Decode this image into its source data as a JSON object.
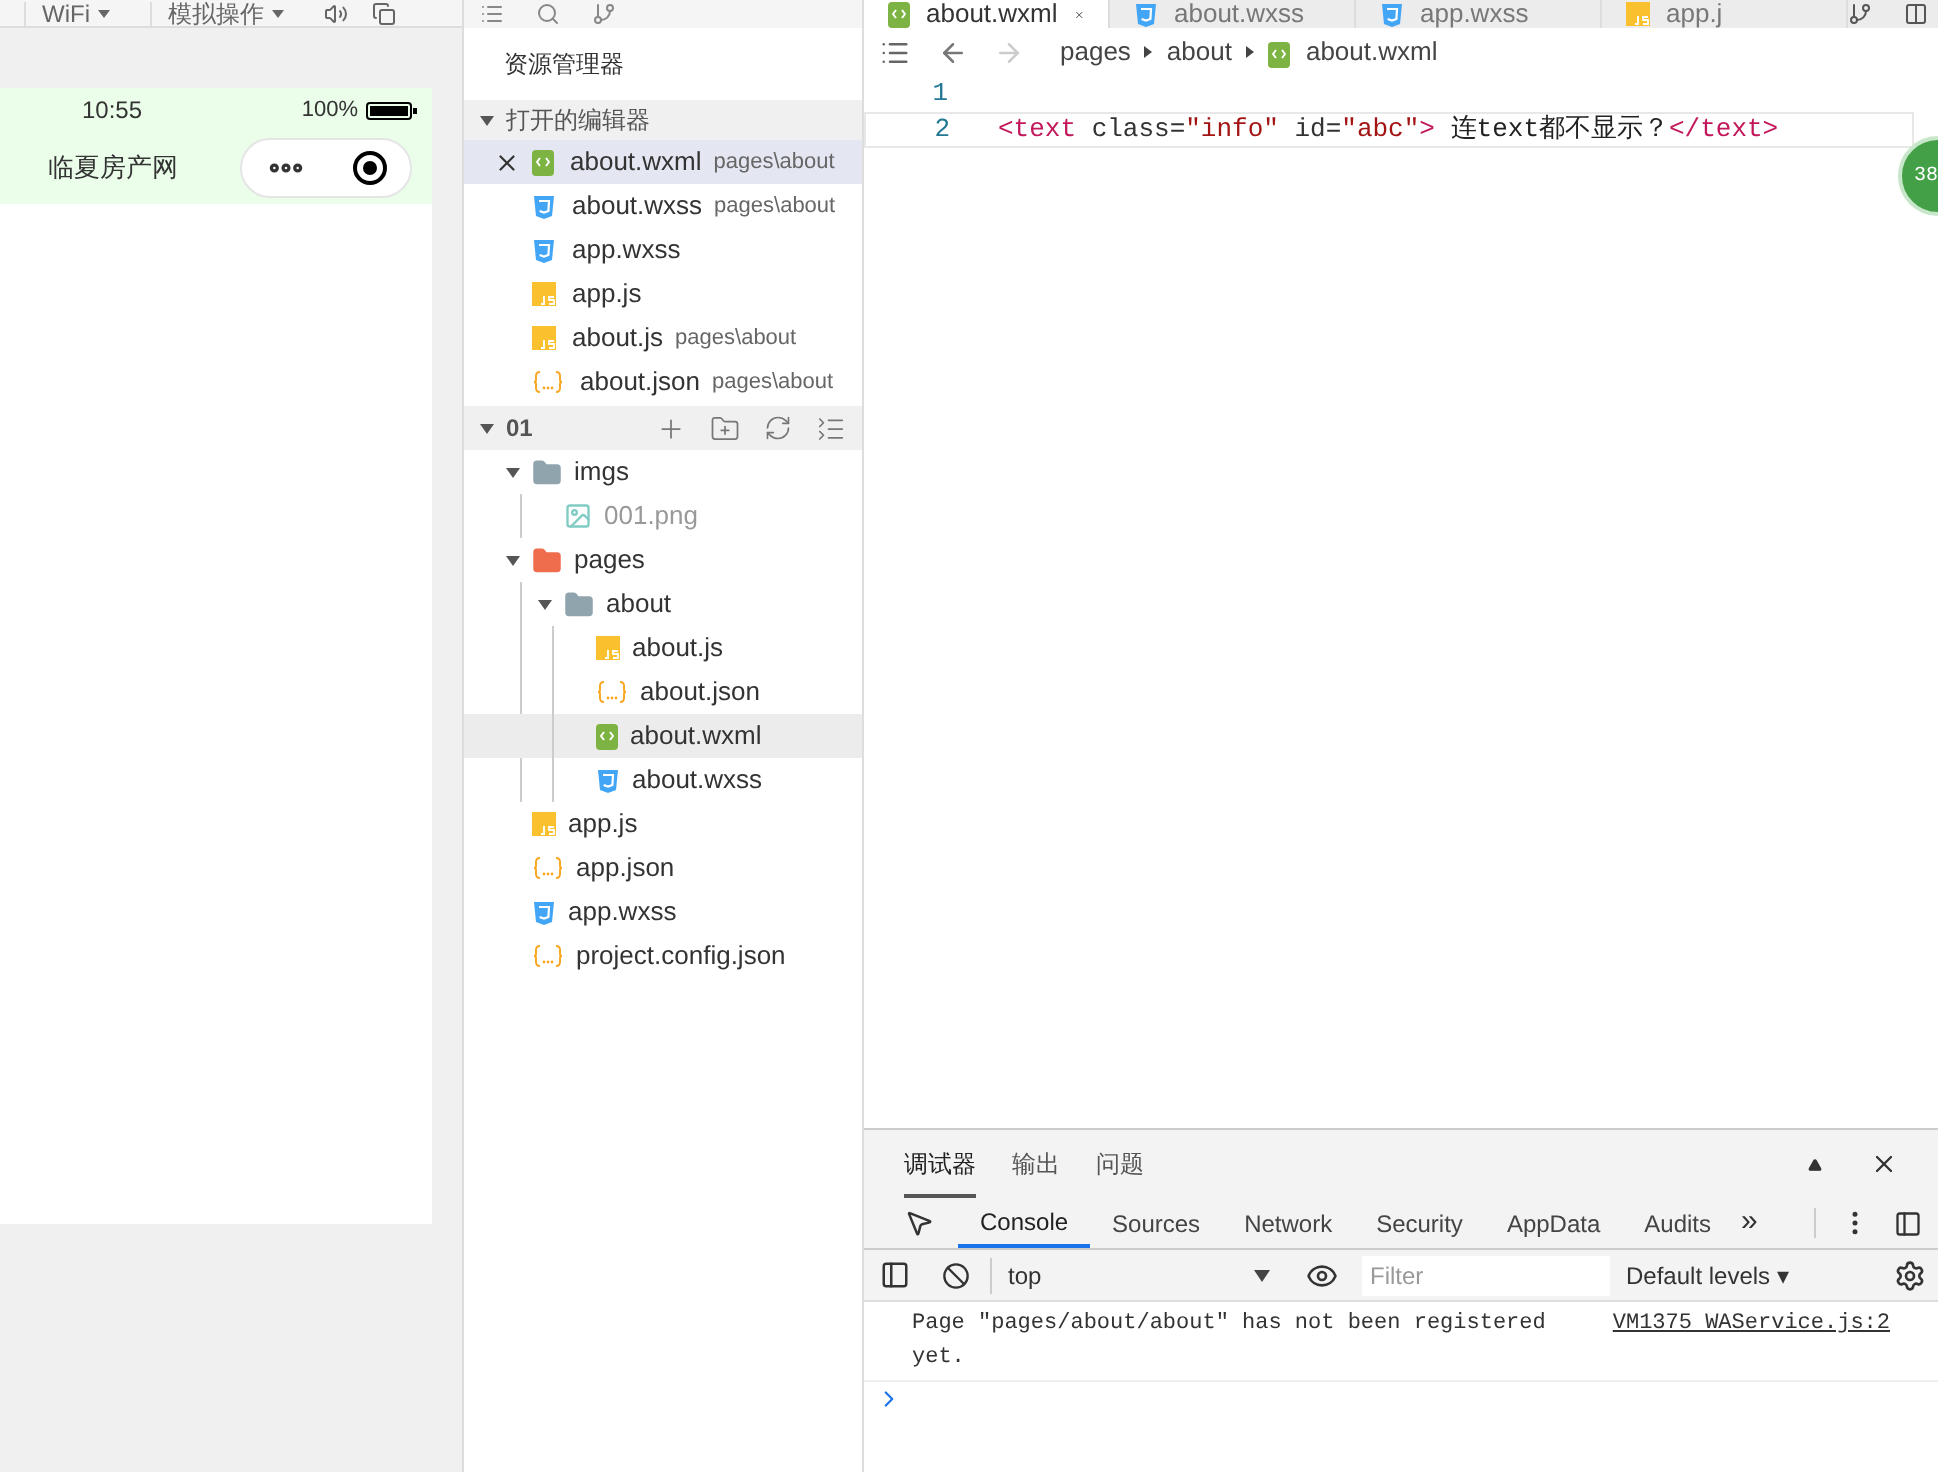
{
  "simulator": {
    "toolbar": [
      "WiFi",
      "模拟操作"
    ],
    "status_bar": {
      "time": "10:55",
      "battery": "100%"
    },
    "nav_title": "临夏房产网"
  },
  "explorer": {
    "title": "资源管理器",
    "open_editors": {
      "label": "打开的编辑器",
      "expanded": true,
      "items": [
        {
          "name": "about.wxml",
          "path": "pages\\about",
          "kind": "wxml",
          "selected": true
        },
        {
          "name": "about.wxss",
          "path": "pages\\about",
          "kind": "wxss",
          "selected": false
        },
        {
          "name": "app.wxss",
          "kind": "wxss",
          "selected": false
        },
        {
          "name": "app.js",
          "kind": "js",
          "selected": false
        },
        {
          "name": "about.js",
          "path": "pages\\about",
          "kind": "js",
          "selected": false
        },
        {
          "name": "about.json",
          "path": "pages\\about",
          "kind": "json",
          "selected": false
        }
      ]
    },
    "project": {
      "label": "01",
      "expanded": true,
      "tree": [
        {
          "name": "imgs",
          "kind": "folder",
          "expanded": true,
          "selected": false,
          "children": [
            {
              "name": "001.png",
              "kind": "image",
              "selected": false
            }
          ]
        },
        {
          "name": "pages",
          "kind": "pages-folder",
          "expanded": true,
          "selected": false,
          "children": [
            {
              "name": "about",
              "kind": "folder",
              "expanded": true,
              "selected": false,
              "children": [
                {
                  "name": "about.js",
                  "kind": "js",
                  "selected": false
                },
                {
                  "name": "about.json",
                  "kind": "json",
                  "selected": false
                },
                {
                  "name": "about.wxml",
                  "kind": "wxml",
                  "selected": true
                },
                {
                  "name": "about.wxss",
                  "kind": "wxss",
                  "selected": false
                }
              ]
            }
          ]
        },
        {
          "name": "app.js",
          "kind": "js",
          "selected": false
        },
        {
          "name": "app.json",
          "kind": "json",
          "selected": false
        },
        {
          "name": "app.wxss",
          "kind": "wxss",
          "selected": false
        },
        {
          "name": "project.config.json",
          "kind": "json",
          "selected": false
        }
      ]
    }
  },
  "editor": {
    "tabs": [
      {
        "label": "about.wxml",
        "kind": "wxml",
        "selected": true
      },
      {
        "label": "about.wxss",
        "kind": "wxss",
        "selected": false
      },
      {
        "label": "app.wxss",
        "kind": "wxss",
        "selected": false
      },
      {
        "label": "app.j",
        "kind": "js",
        "selected": false
      }
    ],
    "breadcrumb": [
      "pages",
      "about",
      "about.wxml"
    ],
    "lines": [
      {
        "number": "1"
      },
      {
        "number": "2",
        "tokens": [
          {
            "kind": "tag",
            "text": "<text"
          },
          {
            "kind": "attr",
            "text": " class="
          },
          {
            "kind": "string",
            "text": "\"info\""
          },
          {
            "kind": "attr",
            "text": " id="
          },
          {
            "kind": "string",
            "text": "\"abc\""
          },
          {
            "kind": "tag",
            "text": ">"
          },
          {
            "kind": "plain",
            "text": " 连text都不显示？"
          },
          {
            "kind": "tag",
            "text": "</text>"
          }
        ]
      }
    ],
    "badge": "38"
  },
  "debugger": {
    "tabs": [
      {
        "label": "调试器",
        "selected": true
      },
      {
        "label": "输出",
        "selected": false
      },
      {
        "label": "问题",
        "selected": false
      }
    ],
    "devtools_tabs": [
      {
        "label": "Console",
        "selected": true
      },
      {
        "label": "Sources",
        "selected": false
      },
      {
        "label": "Network",
        "selected": false
      },
      {
        "label": "Security",
        "selected": false
      },
      {
        "label": "AppData",
        "selected": false
      },
      {
        "label": "Audits",
        "selected": false
      }
    ],
    "more": "»",
    "context": "top",
    "filter_placeholder": "Filter",
    "levels": "Default levels ▾",
    "messages": [
      {
        "text": "Page \"pages/about/about\" has not been registered yet.",
        "source": "VM1375 WAService.js:2"
      }
    ]
  }
}
